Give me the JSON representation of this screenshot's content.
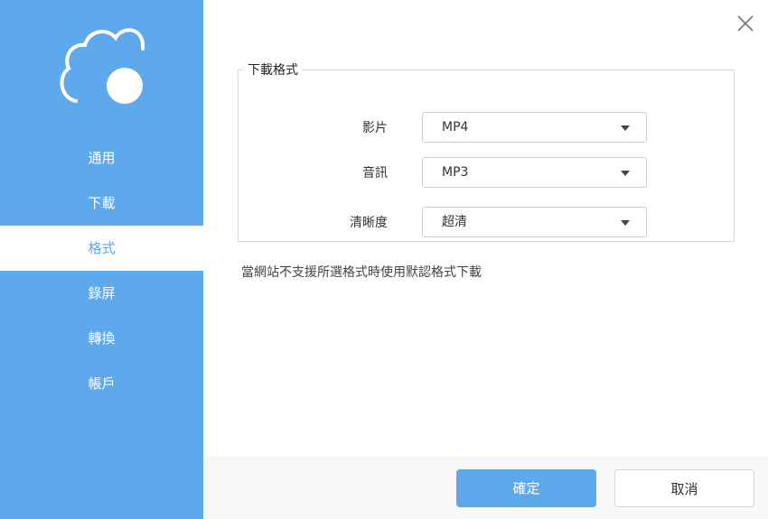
{
  "sidebar": {
    "logo_icon": "cloud-logo-icon",
    "items": [
      {
        "label": "通用",
        "active": false
      },
      {
        "label": "下載",
        "active": false
      },
      {
        "label": "格式",
        "active": true
      },
      {
        "label": "錄屏",
        "active": false
      },
      {
        "label": "轉換",
        "active": false
      },
      {
        "label": "帳戶",
        "active": false
      }
    ]
  },
  "header": {
    "close_icon": "close-icon"
  },
  "format_group": {
    "legend": "下載格式",
    "video": {
      "label": "影片",
      "value": "MP4"
    },
    "audio": {
      "label": "音訊",
      "value": "MP3"
    },
    "quality": {
      "label": "清晰度",
      "value": "超清"
    }
  },
  "hint": "當網站不支援所選格式時使用默認格式下載",
  "footer": {
    "confirm_label": "確定",
    "cancel_label": "取消"
  },
  "colors": {
    "accent": "#5ea8ec",
    "sidebar_bg": "#5ea8ec",
    "footer_bg": "#f8f8f8"
  }
}
